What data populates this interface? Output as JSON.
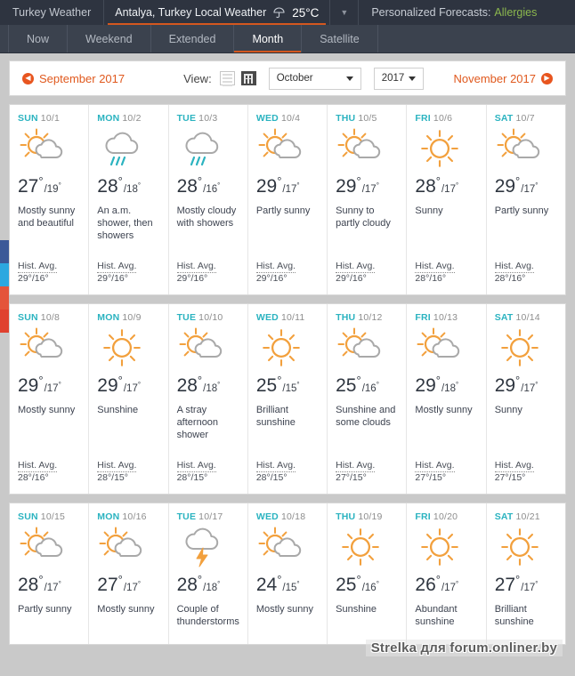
{
  "header": {
    "site_label": "Turkey Weather",
    "location": "Antalya, Turkey Local Weather",
    "current_temp": "25°C",
    "umbrella_icon": "umbrella-icon",
    "dropdown_icon": "chevron-down-icon",
    "personalized_label": "Personalized Forecasts:",
    "personalized_link": "Allergies"
  },
  "tabs": [
    {
      "label": "Now",
      "active": false
    },
    {
      "label": "Weekend",
      "active": false
    },
    {
      "label": "Extended",
      "active": false
    },
    {
      "label": "Month",
      "active": true
    },
    {
      "label": "Satellite",
      "active": false
    }
  ],
  "controls": {
    "prev_label": "September 2017",
    "next_label": "November 2017",
    "prev_icon": "arrow-left-circle-icon",
    "next_icon": "arrow-right-circle-icon",
    "view_label": "View:",
    "view_list_icon": "list-view-icon",
    "view_grid_icon": "grid-view-icon",
    "month_value": "October",
    "year_value": "2017"
  },
  "colors": {
    "accent": "#d4571f",
    "link": "#e0591e",
    "dayname": "#2bb3c0",
    "sun": "#f2a03d",
    "cloud": "#a9a9a9",
    "rain": "#2bb3c0",
    "header_bg": "#2e3440",
    "tab_bg": "#3b424e",
    "page_bg": "#c9c9c9"
  },
  "social_rail": [
    {
      "name": "facebook-share-button",
      "color": "#3b5998"
    },
    {
      "name": "twitter-share-button",
      "color": "#2ca8e0"
    },
    {
      "name": "googleplus-share-button",
      "color": "#e4543a"
    },
    {
      "name": "pinterest-share-button",
      "color": "#e0412f"
    }
  ],
  "watermark": "Strelka для forum.onliner.by",
  "weeks": [
    {
      "days": [
        {
          "dow": "SUN",
          "date": "10/1",
          "icon": "sun-behind-cloud",
          "hi": "27",
          "lo": "19",
          "desc": "Mostly sunny and beautiful",
          "hist_label": "Hist. Avg.",
          "hist_value": "29°/16°"
        },
        {
          "dow": "MON",
          "date": "10/2",
          "icon": "cloud-rain",
          "hi": "28",
          "lo": "18",
          "desc": "An a.m. shower, then showers",
          "hist_label": "Hist. Avg.",
          "hist_value": "29°/16°"
        },
        {
          "dow": "TUE",
          "date": "10/3",
          "icon": "cloud-rain",
          "hi": "28",
          "lo": "16",
          "desc": "Mostly cloudy with showers",
          "hist_label": "Hist. Avg.",
          "hist_value": "29°/16°"
        },
        {
          "dow": "WED",
          "date": "10/4",
          "icon": "sun-behind-cloud",
          "hi": "29",
          "lo": "17",
          "desc": "Partly sunny",
          "hist_label": "Hist. Avg.",
          "hist_value": "29°/16°"
        },
        {
          "dow": "THU",
          "date": "10/5",
          "icon": "sun-behind-cloud",
          "hi": "29",
          "lo": "17",
          "desc": "Sunny to partly cloudy",
          "hist_label": "Hist. Avg.",
          "hist_value": "29°/16°"
        },
        {
          "dow": "FRI",
          "date": "10/6",
          "icon": "sun",
          "hi": "28",
          "lo": "17",
          "desc": "Sunny",
          "hist_label": "Hist. Avg.",
          "hist_value": "28°/16°"
        },
        {
          "dow": "SAT",
          "date": "10/7",
          "icon": "sun-behind-cloud",
          "hi": "29",
          "lo": "17",
          "desc": "Partly sunny",
          "hist_label": "Hist. Avg.",
          "hist_value": "28°/16°"
        }
      ]
    },
    {
      "days": [
        {
          "dow": "SUN",
          "date": "10/8",
          "icon": "sun-behind-cloud",
          "hi": "29",
          "lo": "17",
          "desc": "Mostly sunny",
          "hist_label": "Hist. Avg.",
          "hist_value": "28°/16°"
        },
        {
          "dow": "MON",
          "date": "10/9",
          "icon": "sun",
          "hi": "29",
          "lo": "17",
          "desc": "Sunshine",
          "hist_label": "Hist. Avg.",
          "hist_value": "28°/15°"
        },
        {
          "dow": "TUE",
          "date": "10/10",
          "icon": "sun-behind-cloud",
          "hi": "28",
          "lo": "18",
          "desc": "A stray afternoon shower",
          "hist_label": "Hist. Avg.",
          "hist_value": "28°/15°"
        },
        {
          "dow": "WED",
          "date": "10/11",
          "icon": "sun",
          "hi": "25",
          "lo": "15",
          "desc": "Brilliant sunshine",
          "hist_label": "Hist. Avg.",
          "hist_value": "28°/15°"
        },
        {
          "dow": "THU",
          "date": "10/12",
          "icon": "sun-behind-cloud",
          "hi": "25",
          "lo": "16",
          "desc": "Sunshine and some clouds",
          "hist_label": "Hist. Avg.",
          "hist_value": "27°/15°"
        },
        {
          "dow": "FRI",
          "date": "10/13",
          "icon": "sun-behind-cloud",
          "hi": "29",
          "lo": "18",
          "desc": "Mostly sunny",
          "hist_label": "Hist. Avg.",
          "hist_value": "27°/15°"
        },
        {
          "dow": "SAT",
          "date": "10/14",
          "icon": "sun",
          "hi": "29",
          "lo": "17",
          "desc": "Sunny",
          "hist_label": "Hist. Avg.",
          "hist_value": "27°/15°"
        }
      ]
    },
    {
      "days": [
        {
          "dow": "SUN",
          "date": "10/15",
          "icon": "sun-behind-cloud",
          "hi": "28",
          "lo": "17",
          "desc": "Partly sunny",
          "hist_label": "",
          "hist_value": ""
        },
        {
          "dow": "MON",
          "date": "10/16",
          "icon": "sun-behind-cloud",
          "hi": "27",
          "lo": "17",
          "desc": "Mostly sunny",
          "hist_label": "",
          "hist_value": ""
        },
        {
          "dow": "TUE",
          "date": "10/17",
          "icon": "thunderstorm",
          "hi": "28",
          "lo": "18",
          "desc": "Couple of thunderstorms",
          "hist_label": "",
          "hist_value": ""
        },
        {
          "dow": "WED",
          "date": "10/18",
          "icon": "sun-behind-cloud",
          "hi": "24",
          "lo": "15",
          "desc": "Mostly sunny",
          "hist_label": "",
          "hist_value": ""
        },
        {
          "dow": "THU",
          "date": "10/19",
          "icon": "sun",
          "hi": "25",
          "lo": "16",
          "desc": "Sunshine",
          "hist_label": "",
          "hist_value": ""
        },
        {
          "dow": "FRI",
          "date": "10/20",
          "icon": "sun",
          "hi": "26",
          "lo": "17",
          "desc": "Abundant sunshine",
          "hist_label": "",
          "hist_value": ""
        },
        {
          "dow": "SAT",
          "date": "10/21",
          "icon": "sun",
          "hi": "27",
          "lo": "17",
          "desc": "Brilliant sunshine",
          "hist_label": "",
          "hist_value": ""
        }
      ]
    }
  ]
}
